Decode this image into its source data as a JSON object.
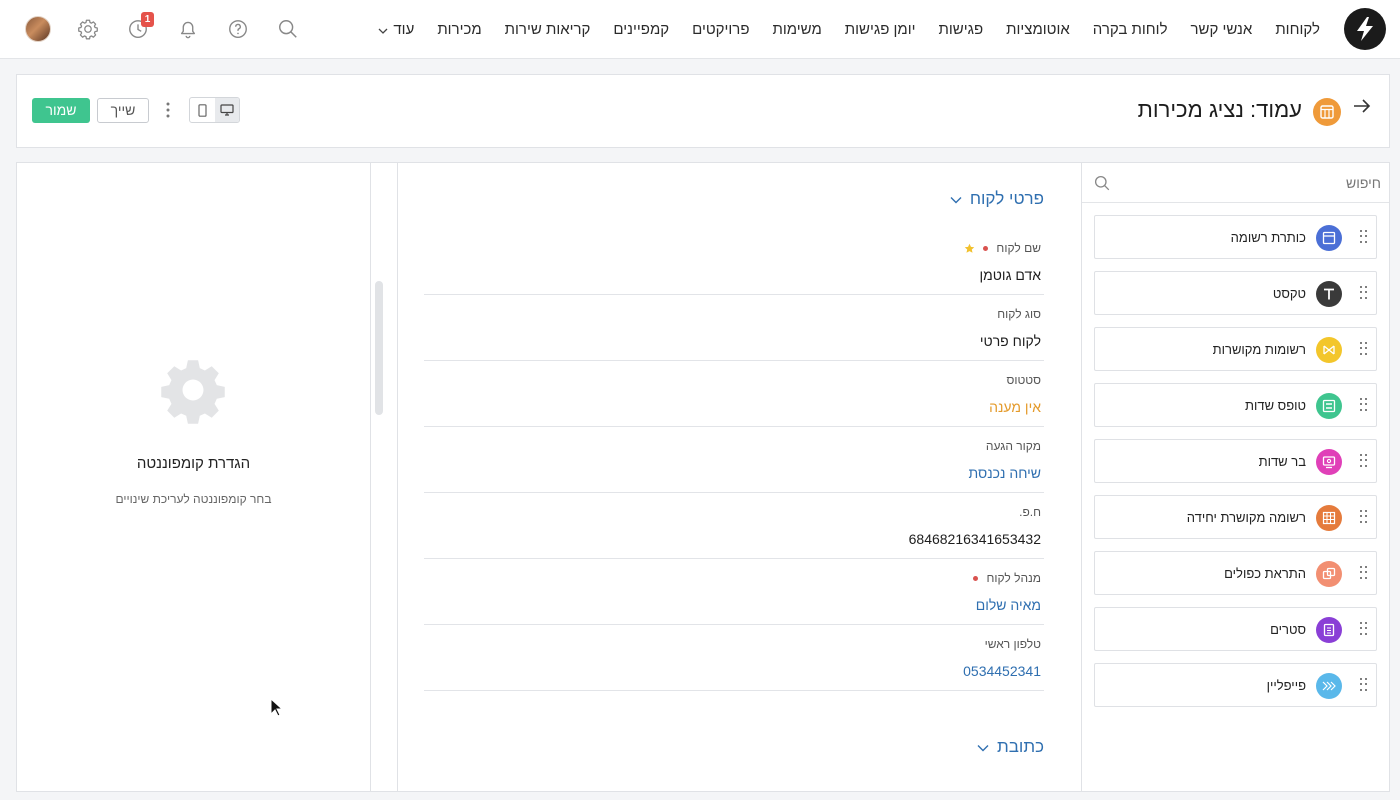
{
  "nav": {
    "items": [
      {
        "id": "customers",
        "label": "לקוחות"
      },
      {
        "id": "contacts",
        "label": "אנשי קשר"
      },
      {
        "id": "dashboards",
        "label": "לוחות בקרה"
      },
      {
        "id": "automations",
        "label": "אוטומציות"
      },
      {
        "id": "meetings",
        "label": "פגישות"
      },
      {
        "id": "meetings-calendar",
        "label": "יומן פגישות"
      },
      {
        "id": "tasks",
        "label": "משימות"
      },
      {
        "id": "projects",
        "label": "פרויקטים"
      },
      {
        "id": "campaigns",
        "label": "קמפיינים"
      },
      {
        "id": "service-calls",
        "label": "קריאות שירות"
      },
      {
        "id": "sales",
        "label": "מכירות"
      },
      {
        "id": "more",
        "label": "עוד"
      }
    ],
    "history_badge": "1"
  },
  "header": {
    "title": "עמוד: נציג מכירות",
    "save_label": "שמור",
    "share_label": "שייך"
  },
  "components": {
    "search_placeholder": "חיפוש",
    "items": [
      {
        "label": "כותרת רשומה",
        "icon": "record-header-icon",
        "color": "#4b6fd6"
      },
      {
        "label": "טקסט",
        "icon": "text-icon",
        "color": "#3a3a3a"
      },
      {
        "label": "רשומות מקושרות",
        "icon": "linked-records-icon",
        "color": "#f3c62b"
      },
      {
        "label": "טופס שדות",
        "icon": "fields-form-icon",
        "color": "#3fc58f"
      },
      {
        "label": "בר שדות",
        "icon": "fields-bar-icon",
        "color": "#e040b8"
      },
      {
        "label": "רשומה מקושרת יחידה",
        "icon": "single-linked-record-icon",
        "color": "#e57b3c"
      },
      {
        "label": "התראת כפולים",
        "icon": "duplicates-alert-icon",
        "color": "#f28f72"
      },
      {
        "label": "סטרים",
        "icon": "stream-icon",
        "color": "#8a3fd6"
      },
      {
        "label": "פייפליין",
        "icon": "pipeline-icon",
        "color": "#5ab8ea"
      }
    ]
  },
  "form": {
    "section1": "פרטי לקוח",
    "section2": "כתובת",
    "fields": [
      {
        "label": "שם לקוח",
        "value": "אדם גוטמן"
      },
      {
        "label": "סוג לקוח",
        "value": "לקוח פרטי"
      },
      {
        "label": "סטטוס",
        "value": "אין מענה"
      },
      {
        "label": "מקור הגעה",
        "value": "שיחה נכנסת"
      },
      {
        "label": "ח.פ.",
        "value": "68468216341653432"
      },
      {
        "label": "מנהל לקוח",
        "value": "מאיה שלום"
      },
      {
        "label": "טלפון ראשי",
        "value": "0534452341"
      }
    ]
  },
  "settings": {
    "title": "הגדרת קומפוננטה",
    "subtitle": "בחר קומפוננטה לעריכת שינויים"
  },
  "colors": {
    "accent_green": "#3fc58f",
    "link_blue": "#2f6fb0",
    "status_orange": "#e49a2a",
    "page_icon_orange": "#ef9a3a"
  }
}
